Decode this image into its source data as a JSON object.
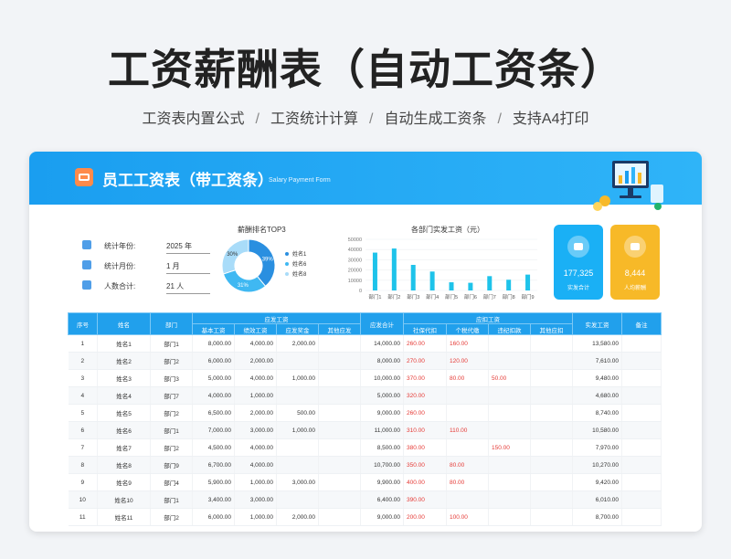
{
  "page": {
    "title": "工资薪酬表（自动工资条）",
    "features": [
      "工资表内置公式",
      "工资统计计算",
      "自动生成工资条",
      "支持A4打印"
    ]
  },
  "header": {
    "title": "员工工资表（带工资条）",
    "subtitle": "Salary Payment Form",
    "color": "#1a9ef0"
  },
  "info": [
    {
      "label": "统计年份:",
      "value": "2025 年",
      "icon": "calendar-icon"
    },
    {
      "label": "统计月份:",
      "value": "1 月",
      "icon": "document-icon"
    },
    {
      "label": "人数合计:",
      "value": "21 人",
      "icon": "people-icon"
    }
  ],
  "kpis": [
    {
      "value": "177,325",
      "label": "实发合计",
      "color": "#1ab0f5",
      "icon": "wallet-icon"
    },
    {
      "value": "8,444",
      "label": "人均薪酬",
      "color": "#f7b928",
      "icon": "coin-icon"
    }
  ],
  "chart_data": [
    {
      "type": "pie",
      "title": "薪酬排名TOP3",
      "categories": [
        "姓名1",
        "姓名6",
        "姓名8"
      ],
      "values": [
        39,
        31,
        30
      ],
      "value_labels": [
        "39%",
        "31%",
        "30%"
      ],
      "colors": [
        "#2a8fe0",
        "#3fb8f2",
        "#a9dcf9"
      ],
      "legend": "right"
    },
    {
      "type": "bar",
      "title": "各部门实发工资（元）",
      "categories": [
        "部门1",
        "部门2",
        "部门3",
        "部门4",
        "部门5",
        "部门6",
        "部门7",
        "部门8",
        "部门9"
      ],
      "values": [
        37000,
        41000,
        25000,
        18500,
        8000,
        7500,
        14000,
        10500,
        15500
      ],
      "y_ticks": [
        "50000",
        "40000",
        "30000",
        "20000",
        "10000",
        "0"
      ],
      "ylim": [
        0,
        50000
      ],
      "color": "#1ec3ea",
      "grid": true
    }
  ],
  "table": {
    "group_headers": {
      "payable": "应发工资",
      "deduction": "应扣工资"
    },
    "headers": {
      "seq": "序号",
      "name": "姓名",
      "dept": "部门",
      "base": "基本工资",
      "perf": "绩效工资",
      "bonus": "应发奖金",
      "other_pay": "其他应发",
      "gross": "应发合计",
      "social": "社保代扣",
      "tax": "个税代缴",
      "absence": "违纪扣款",
      "other_ded": "其他应扣",
      "net": "实发工资",
      "note": "备注"
    },
    "rows": [
      {
        "seq": "1",
        "name": "姓名1",
        "dept": "部门1",
        "base": "8,000.00",
        "perf": "4,000.00",
        "bonus": "2,000.00",
        "other_pay": "",
        "gross": "14,000.00",
        "social": "260.00",
        "tax": "160.00",
        "absence": "",
        "other_ded": "",
        "net": "13,580.00",
        "note": ""
      },
      {
        "seq": "2",
        "name": "姓名2",
        "dept": "部门2",
        "base": "6,000.00",
        "perf": "2,000.00",
        "bonus": "",
        "other_pay": "",
        "gross": "8,000.00",
        "social": "270.00",
        "tax": "120.00",
        "absence": "",
        "other_ded": "",
        "net": "7,610.00",
        "note": ""
      },
      {
        "seq": "3",
        "name": "姓名3",
        "dept": "部门3",
        "base": "5,000.00",
        "perf": "4,000.00",
        "bonus": "1,000.00",
        "other_pay": "",
        "gross": "10,000.00",
        "social": "370.00",
        "tax": "80.00",
        "absence": "50.00",
        "other_ded": "",
        "net": "9,480.00",
        "note": ""
      },
      {
        "seq": "4",
        "name": "姓名4",
        "dept": "部门7",
        "base": "4,000.00",
        "perf": "1,000.00",
        "bonus": "",
        "other_pay": "",
        "gross": "5,000.00",
        "social": "320.00",
        "tax": "",
        "absence": "",
        "other_ded": "",
        "net": "4,680.00",
        "note": ""
      },
      {
        "seq": "5",
        "name": "姓名5",
        "dept": "部门2",
        "base": "6,500.00",
        "perf": "2,000.00",
        "bonus": "500.00",
        "other_pay": "",
        "gross": "9,000.00",
        "social": "260.00",
        "tax": "",
        "absence": "",
        "other_ded": "",
        "net": "8,740.00",
        "note": ""
      },
      {
        "seq": "6",
        "name": "姓名6",
        "dept": "部门1",
        "base": "7,000.00",
        "perf": "3,000.00",
        "bonus": "1,000.00",
        "other_pay": "",
        "gross": "11,000.00",
        "social": "310.00",
        "tax": "110.00",
        "absence": "",
        "other_ded": "",
        "net": "10,580.00",
        "note": ""
      },
      {
        "seq": "7",
        "name": "姓名7",
        "dept": "部门2",
        "base": "4,500.00",
        "perf": "4,000.00",
        "bonus": "",
        "other_pay": "",
        "gross": "8,500.00",
        "social": "380.00",
        "tax": "",
        "absence": "150.00",
        "other_ded": "",
        "net": "7,970.00",
        "note": ""
      },
      {
        "seq": "8",
        "name": "姓名8",
        "dept": "部门9",
        "base": "6,700.00",
        "perf": "4,000.00",
        "bonus": "",
        "other_pay": "",
        "gross": "10,700.00",
        "social": "350.00",
        "tax": "80.00",
        "absence": "",
        "other_ded": "",
        "net": "10,270.00",
        "note": ""
      },
      {
        "seq": "9",
        "name": "姓名9",
        "dept": "部门4",
        "base": "5,900.00",
        "perf": "1,000.00",
        "bonus": "3,000.00",
        "other_pay": "",
        "gross": "9,900.00",
        "social": "400.00",
        "tax": "80.00",
        "absence": "",
        "other_ded": "",
        "net": "9,420.00",
        "note": ""
      },
      {
        "seq": "10",
        "name": "姓名10",
        "dept": "部门1",
        "base": "3,400.00",
        "perf": "3,000.00",
        "bonus": "",
        "other_pay": "",
        "gross": "6,400.00",
        "social": "390.00",
        "tax": "",
        "absence": "",
        "other_ded": "",
        "net": "6,010.00",
        "note": ""
      },
      {
        "seq": "11",
        "name": "姓名11",
        "dept": "部门2",
        "base": "6,000.00",
        "perf": "1,000.00",
        "bonus": "2,000.00",
        "other_pay": "",
        "gross": "9,000.00",
        "social": "200.00",
        "tax": "100.00",
        "absence": "",
        "other_ded": "",
        "net": "8,700.00",
        "note": ""
      }
    ]
  }
}
